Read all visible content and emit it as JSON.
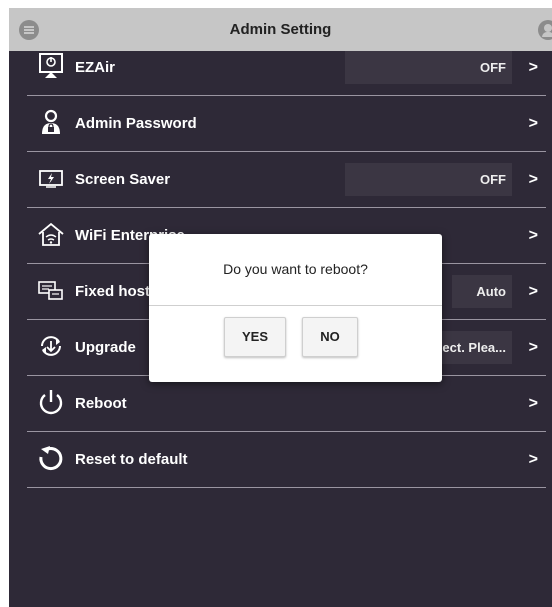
{
  "header": {
    "title": "Admin Setting",
    "menu_icon": "menu-icon",
    "user_icon": "user-icon"
  },
  "rows": [
    {
      "label": "EZAir",
      "value": "OFF",
      "icon": "ezair-icon"
    },
    {
      "label": "Admin Password",
      "value": "",
      "icon": "lock-person-icon"
    },
    {
      "label": "Screen Saver",
      "value": "OFF",
      "icon": "screen-saver-icon"
    },
    {
      "label": "WiFi Enterprise",
      "value": "",
      "icon": "home-wifi-icon"
    },
    {
      "label": "Fixed host",
      "value": "Auto",
      "icon": "network-icon"
    },
    {
      "label": "Upgrade",
      "value": "ect. Plea...",
      "icon": "upgrade-icon"
    },
    {
      "label": "Reboot",
      "value": "",
      "icon": "power-icon"
    },
    {
      "label": "Reset to default",
      "value": "",
      "icon": "reset-icon"
    }
  ],
  "chevron": ">",
  "dialog": {
    "message": "Do you want to reboot?",
    "yes_label": "YES",
    "no_label": "NO"
  },
  "colors": {
    "background": "#2e2937",
    "header": "#c6c6c6",
    "dialog": "#ffffff"
  }
}
